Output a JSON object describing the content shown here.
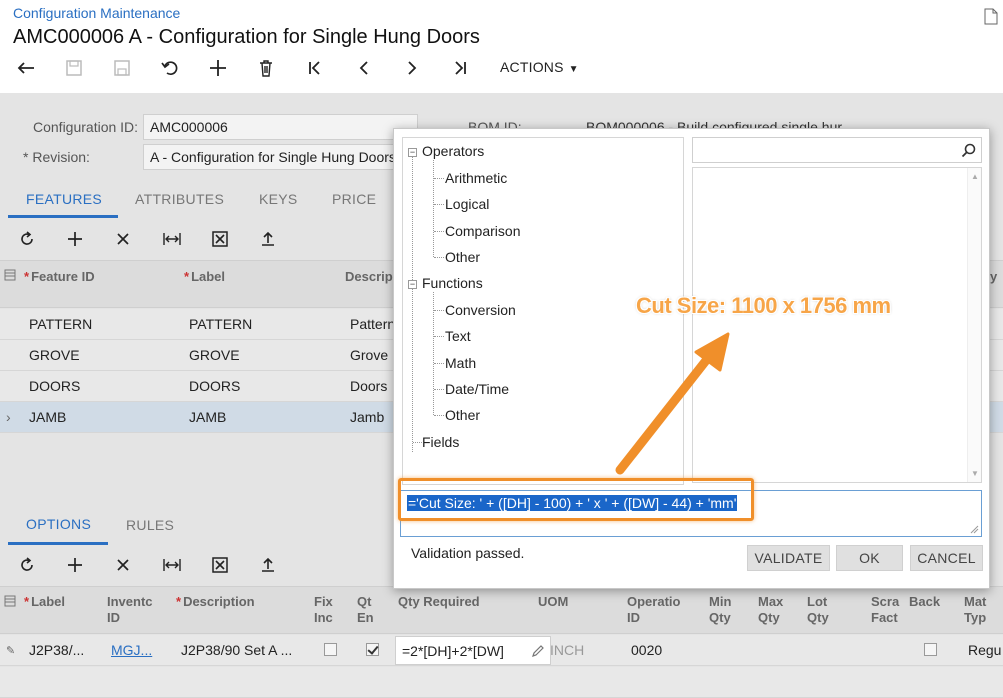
{
  "header": {
    "breadcrumb": "Configuration Maintenance",
    "title": "AMC000006 A - Configuration for Single Hung Doors",
    "actions_label": "ACTIONS"
  },
  "form": {
    "config_id_label": "Configuration ID:",
    "config_id_value": "AMC000006",
    "revision_label": "* Revision:",
    "revision_value": "A - Configuration for Single Hung Doors",
    "bom_id_label": "BOM ID:",
    "bom_id_value": "BOM000006 - Build configured single hur"
  },
  "tabs": {
    "top": [
      "FEATURES",
      "ATTRIBUTES",
      "KEYS",
      "PRICE"
    ],
    "bottom": [
      "OPTIONS",
      "RULES"
    ]
  },
  "features_grid": {
    "headers": [
      "Feature ID",
      "Label",
      "Descrip"
    ],
    "rows": [
      {
        "id": "PATTERN",
        "label": "PATTERN",
        "desc": "Pattern"
      },
      {
        "id": "GROVE",
        "label": "GROVE",
        "desc": "Grove"
      },
      {
        "id": "DOORS",
        "label": "DOORS",
        "desc": "Doors"
      },
      {
        "id": "JAMB",
        "label": "JAMB",
        "desc": "Jamb"
      }
    ],
    "edge_header": "y"
  },
  "options_grid": {
    "headers": {
      "label": "Label",
      "inventory_l1": "Inventc",
      "inventory_l2": "ID",
      "description": "Description",
      "fixed_l1": "Fix",
      "fixed_l2": "Inc",
      "qty_en_l1": "Qt",
      "qty_en_l2": "En",
      "qty_required": "Qty Required",
      "uom": "UOM",
      "operation_l1": "Operatio",
      "operation_l2": "ID",
      "min_l1": "Min",
      "min_l2": "Qty",
      "max_l1": "Max",
      "max_l2": "Qty",
      "lot_l1": "Lot",
      "lot_l2": "Qty",
      "scrap_l1": "Scra",
      "scrap_l2": "Fact",
      "back": "Back",
      "mat_l1": "Mat",
      "mat_l2": "Typ"
    },
    "row1": {
      "label": "J2P38/...",
      "inventory": "MGJ...",
      "description": "J2P38/90 Set A ...",
      "qty_required": "=2*[DH]+2*[DW]",
      "uom": "INCH",
      "operation": "0020",
      "mat": "Regu"
    }
  },
  "dialog": {
    "tree": {
      "operators": "Operators",
      "operators_children": [
        "Arithmetic",
        "Logical",
        "Comparison",
        "Other"
      ],
      "functions": "Functions",
      "functions_children": [
        "Conversion",
        "Text",
        "Math",
        "Date/Time",
        "Other"
      ],
      "fields": "Fields"
    },
    "formula": "='Cut Size: ' + ([DH] - 100) + ' x ' + ([DW] - 44) + 'mm'",
    "validation": "Validation passed.",
    "buttons": {
      "validate": "VALIDATE",
      "ok": "OK",
      "cancel": "CANCEL"
    }
  },
  "annotation": {
    "callout": "Cut Size: 1100 x 1756 mm",
    "accent": "#f08f2a"
  }
}
